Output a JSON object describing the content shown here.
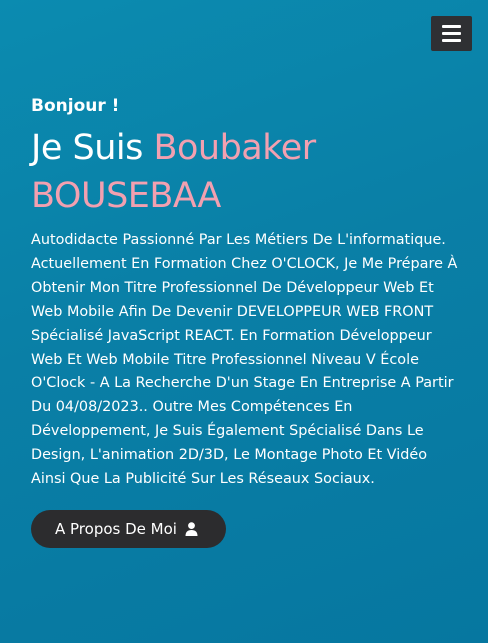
{
  "nav": {
    "menu_icon": "hamburger-menu-icon"
  },
  "hero": {
    "greeting": "Bonjour !",
    "headline_prefix": "Je Suis ",
    "headline_name": "Boubaker BOUSEBAA",
    "intro": "Autodidacte Passionné Par Les Métiers De L'informatique. Actuellement En Formation Chez O'CLOCK, Je Me Prépare À Obtenir Mon Titre Professionnel De Développeur Web Et Web Mobile Afin De Devenir DEVELOPPEUR WEB FRONT Spécialisé JavaScript REACT. En Formation Développeur Web Et Web Mobile Titre Professionnel Niveau V École O'Clock - A La Recherche D'un Stage En Entreprise A Partir Du 04/08/2023.. Outre Mes Compétences En Développement, Je Suis Également Spécialisé Dans Le Design, L'animation 2D/3D, Le Montage Photo Et Vidéo Ainsi Que La Publicité Sur Les Réseaux Sociaux.",
    "cta_label": "A Propos De Moi",
    "cta_icon": "user-icon"
  },
  "colors": {
    "background": "#0a82a9",
    "accent_name": "#f2a0b0",
    "button_bg": "#2c2c2e"
  }
}
